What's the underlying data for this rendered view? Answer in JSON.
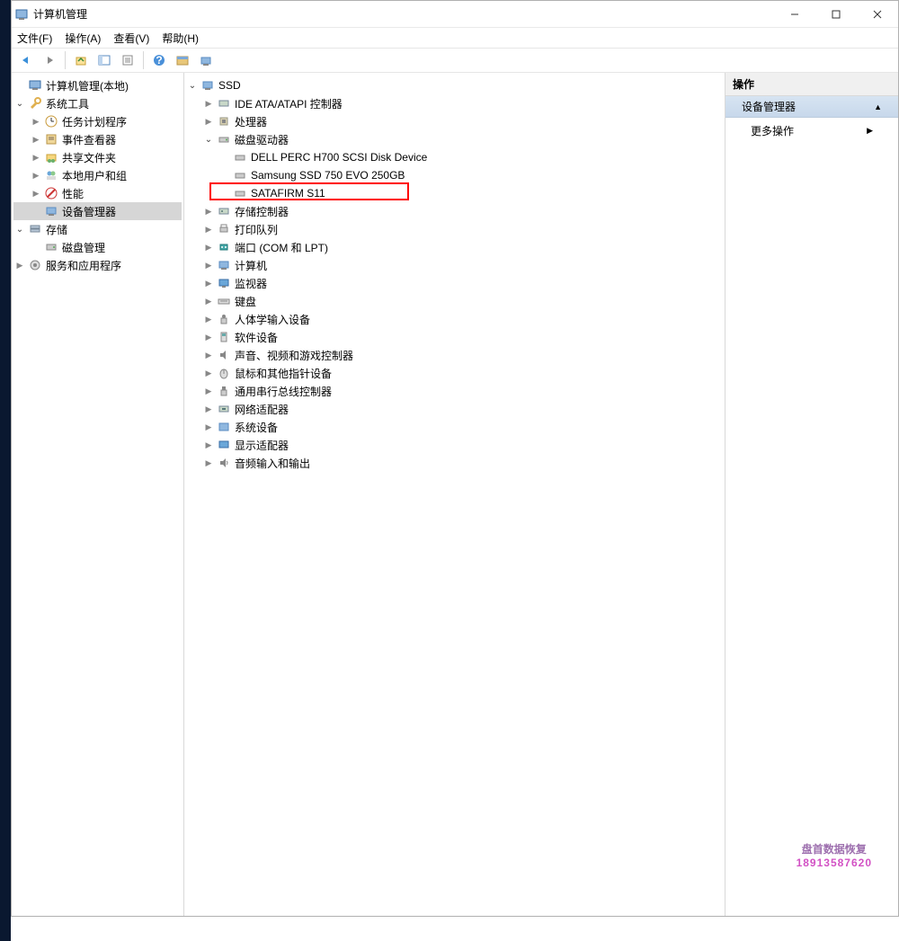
{
  "window": {
    "title": "计算机管理"
  },
  "menu": {
    "file": "文件(F)",
    "action": "操作(A)",
    "view": "查看(V)",
    "help": "帮助(H)"
  },
  "left_tree": {
    "root": "计算机管理(本地)",
    "system_tools": "系统工具",
    "task_scheduler": "任务计划程序",
    "event_viewer": "事件查看器",
    "shared_folders": "共享文件夹",
    "local_users": "本地用户和组",
    "performance": "性能",
    "device_manager": "设备管理器",
    "storage": "存储",
    "disk_management": "磁盘管理",
    "services_apps": "服务和应用程序"
  },
  "mid_tree": {
    "root": "SSD",
    "ide": "IDE ATA/ATAPI 控制器",
    "cpu": "处理器",
    "disk_drives": "磁盘驱动器",
    "disk1": "DELL PERC H700 SCSI Disk Device",
    "disk2": "Samsung SSD 750 EVO 250GB",
    "disk3": "SATAFIRM   S11",
    "storage_ctrl": "存储控制器",
    "print_queues": "打印队列",
    "ports": "端口 (COM 和 LPT)",
    "computer": "计算机",
    "monitors": "监视器",
    "keyboards": "键盘",
    "hid": "人体学输入设备",
    "software_dev": "软件设备",
    "sound": "声音、视频和游戏控制器",
    "mice": "鼠标和其他指针设备",
    "usb": "通用串行总线控制器",
    "network": "网络适配器",
    "system_dev": "系统设备",
    "display": "显示适配器",
    "audio_io": "音频输入和输出"
  },
  "right": {
    "header": "操作",
    "section": "设备管理器",
    "more": "更多操作"
  },
  "watermark": {
    "line1": "盘首数据恢复",
    "line2": "18913587620"
  }
}
